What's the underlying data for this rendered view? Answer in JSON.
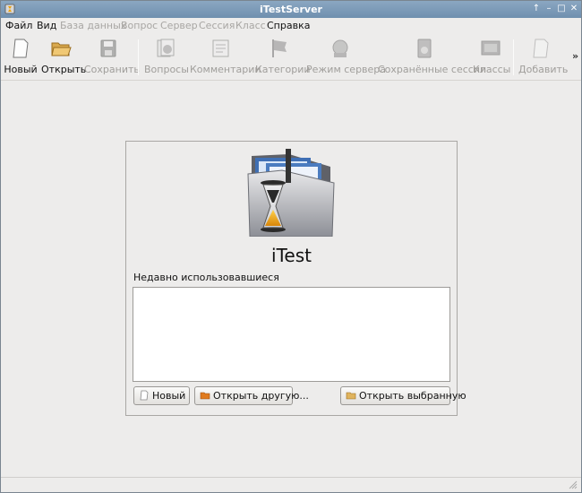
{
  "window": {
    "title": "iTestServer"
  },
  "menubar": {
    "items": [
      {
        "label": "Файл",
        "enabled": true
      },
      {
        "label": "Вид",
        "enabled": true
      },
      {
        "label": "База данных",
        "enabled": false
      },
      {
        "label": "Вопрос",
        "enabled": false
      },
      {
        "label": "Сервер",
        "enabled": false
      },
      {
        "label": "Сессия",
        "enabled": false
      },
      {
        "label": "Класс",
        "enabled": false
      },
      {
        "label": "Справка",
        "enabled": true
      }
    ]
  },
  "toolbar": {
    "items": [
      {
        "label": "Новый",
        "icon": "new-document-icon",
        "enabled": true
      },
      {
        "label": "Открыть",
        "icon": "open-folder-icon",
        "enabled": true
      },
      {
        "label": "Сохранить",
        "icon": "save-icon",
        "enabled": false
      },
      {
        "label": "Вопросы",
        "icon": "questions-icon",
        "enabled": false
      },
      {
        "label": "Комментарии",
        "icon": "comments-icon",
        "enabled": false
      },
      {
        "label": "Категории",
        "icon": "categories-flag-icon",
        "enabled": false
      },
      {
        "label": "Режим сервера",
        "icon": "server-mode-icon",
        "enabled": false
      },
      {
        "label": "Сохранённые сессии",
        "icon": "saved-sessions-icon",
        "enabled": false
      },
      {
        "label": "Классы",
        "icon": "classes-icon",
        "enabled": false
      },
      {
        "label": "Добавить",
        "icon": "add-icon",
        "enabled": false
      }
    ],
    "overflow": "»"
  },
  "start_panel": {
    "app_name": "iTest",
    "recent_label": "Недавно использовавшиеся",
    "recent_items": [],
    "buttons": {
      "new": "Новый",
      "open_other": "Открыть другую...",
      "open_selected": "Открыть выбранную"
    }
  }
}
